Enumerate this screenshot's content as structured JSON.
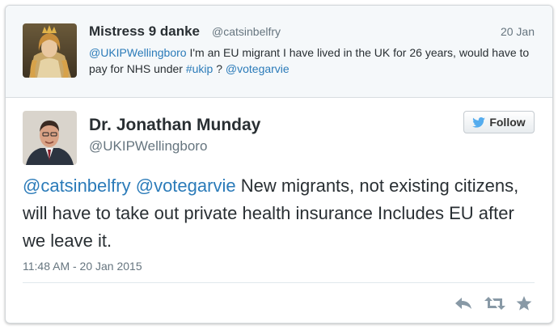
{
  "colors": {
    "link": "#2b7bb9",
    "text": "#292f33",
    "muted": "#66757f",
    "twitter_blue": "#55acee"
  },
  "parent_tweet": {
    "avatar_icon": "painted-portrait-avatar",
    "display_name": "Mistress 9 danke",
    "handle": "@catsinbelfry",
    "date": "20 Jan",
    "text_parts": [
      {
        "text": "@UKIPWellingboro",
        "link": true
      },
      {
        "text": "  I'm an EU migrant I have lived in the UK for 26 years, would have to pay for NHS under ",
        "link": false
      },
      {
        "text": "#ukip",
        "link": true
      },
      {
        "text": " ?  ",
        "link": false
      },
      {
        "text": "@votegarvie",
        "link": true
      }
    ]
  },
  "main_tweet": {
    "avatar_icon": "man-portrait-avatar",
    "display_name": "Dr. Jonathan Munday",
    "handle": "@UKIPWellingboro",
    "follow_label": "Follow",
    "text_parts": [
      {
        "text": "@catsinbelfry",
        "link": true
      },
      {
        "text": " ",
        "link": false
      },
      {
        "text": "@votegarvie",
        "link": true
      },
      {
        "text": " New migrants, not existing citizens, will have to take out private health insurance Includes EU after we leave it.",
        "link": false
      }
    ],
    "timestamp": "11:48 AM - 20 Jan 2015"
  },
  "actions": [
    "reply-icon",
    "retweet-icon",
    "favorite-icon"
  ]
}
